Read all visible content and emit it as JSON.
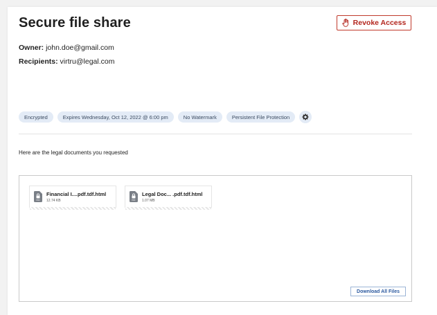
{
  "header": {
    "title": "Secure file share",
    "revoke_label": "Revoke Access"
  },
  "owner": {
    "label": "Owner:",
    "value": "john.doe@gmail.com"
  },
  "recipients": {
    "label": "Recipients:",
    "value": "virtru@legal.com"
  },
  "chips": [
    "Encrypted",
    "Expires Wednesday, Oct 12, 2022 @ 6:00 pm",
    "No Watermark",
    "Persistent File Protection"
  ],
  "message": "Here are the legal documents you requested",
  "files": [
    {
      "name": "Financial I....pdf.tdf.html",
      "size": "12.74 KB",
      "icon": "locked-pdf-icon",
      "icon_label": "PDF"
    },
    {
      "name": "Legal Doc... .pdf.tdf.html",
      "size": "1.07 MB",
      "icon": "locked-pdf-icon",
      "icon_label": "PDF"
    }
  ],
  "download_all_label": "Download All Files",
  "colors": {
    "accent_red": "#b3261e",
    "chip_bg": "#e3ebf6",
    "link_blue": "#2c5aa0"
  }
}
